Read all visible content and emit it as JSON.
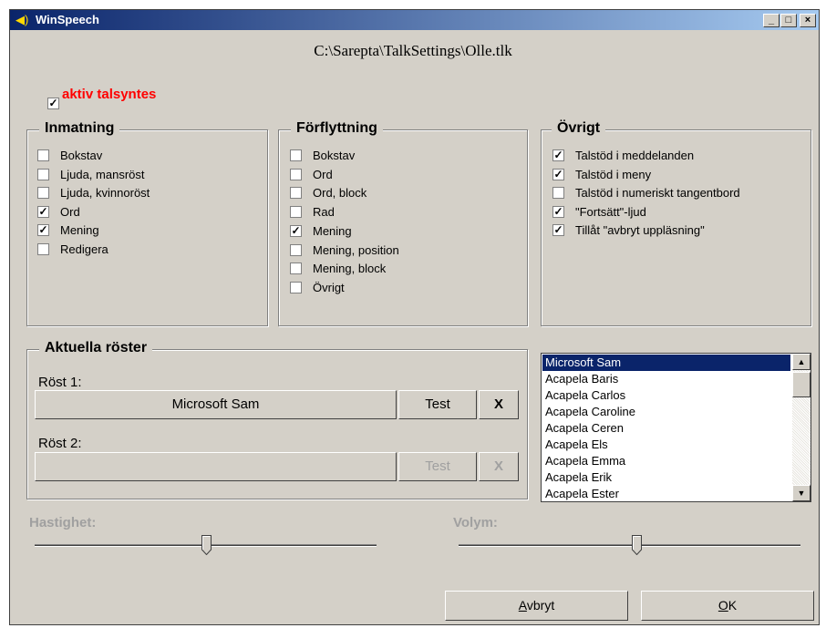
{
  "window": {
    "title": "WinSpeech",
    "controls": {
      "minimize": "_",
      "maximize": "□",
      "close": "×"
    }
  },
  "file_path": "C:\\Sarepta\\TalkSettings\\Olle.tlk",
  "aktiv": {
    "label": "aktiv talsyntes",
    "checked": true
  },
  "groups": {
    "inmatning": {
      "title": "Inmatning",
      "items": [
        {
          "label": "Bokstav",
          "checked": false
        },
        {
          "label": "Ljuda, mansröst",
          "checked": false
        },
        {
          "label": "Ljuda, kvinnoröst",
          "checked": false
        },
        {
          "label": "Ord",
          "checked": true
        },
        {
          "label": "Mening",
          "checked": true
        },
        {
          "label": "Redigera",
          "checked": false
        }
      ]
    },
    "forflyttning": {
      "title": "Förflyttning",
      "items": [
        {
          "label": "Bokstav",
          "checked": false
        },
        {
          "label": "Ord",
          "checked": false
        },
        {
          "label": "Ord, block",
          "checked": false
        },
        {
          "label": "Rad",
          "checked": false
        },
        {
          "label": "Mening",
          "checked": true
        },
        {
          "label": "Mening, position",
          "checked": false
        },
        {
          "label": "Mening, block",
          "checked": false
        },
        {
          "label": "Övrigt",
          "checked": false
        }
      ]
    },
    "ovrigt": {
      "title": "Övrigt",
      "items": [
        {
          "label": "Talstöd i meddelanden",
          "checked": true
        },
        {
          "label": "Talstöd i meny",
          "checked": true
        },
        {
          "label": "Talstöd i numeriskt tangentbord",
          "checked": false
        },
        {
          "label": "\"Fortsätt\"-ljud",
          "checked": true
        },
        {
          "label": "Tillåt \"avbryt uppläsning\"",
          "checked": true
        }
      ]
    }
  },
  "voices": {
    "title": "Aktuella röster",
    "voice1": {
      "label": "Röst 1:",
      "name": "Microsoft Sam",
      "test": "Test",
      "clear": "X"
    },
    "voice2": {
      "label": "Röst 2:",
      "name": "",
      "test": "Test",
      "clear": "X"
    }
  },
  "voice_list": {
    "selected": "Microsoft Sam",
    "items": [
      "Microsoft Sam",
      "Acapela Baris",
      "Acapela Carlos",
      "Acapela Caroline",
      "Acapela Ceren",
      "Acapela Els",
      "Acapela Emma",
      "Acapela Erik",
      "Acapela Ester"
    ],
    "scroll_up": "▲",
    "scroll_down": "▼"
  },
  "sliders": {
    "hastighet": {
      "label": "Hastighet:",
      "value_fraction": 0.5
    },
    "volym": {
      "label": "Volym:",
      "value_fraction": 0.52
    }
  },
  "buttons": {
    "cancel": "Avbryt",
    "cancel_mnemonic": "A",
    "ok": "OK",
    "ok_mnemonic": "O"
  },
  "colors": {
    "accent_red": "#ff0000",
    "titlebar": "#0a246a",
    "face": "#d4d0c8",
    "selection": "#0a246a"
  }
}
